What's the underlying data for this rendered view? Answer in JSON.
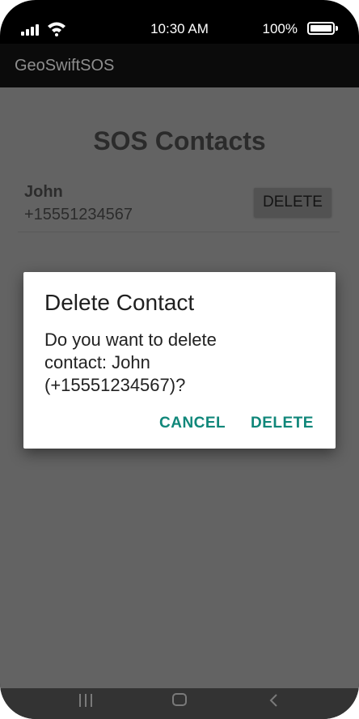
{
  "status_bar": {
    "time": "10:30 AM",
    "battery": "100%",
    "icons": [
      "signal-icon",
      "wifi-icon",
      "battery-icon"
    ]
  },
  "app_bar": {
    "title": "GeoSwiftSOS"
  },
  "screen": {
    "title": "SOS Contacts",
    "contacts": [
      {
        "name": "John",
        "phone": "+15551234567",
        "delete_label": "DELETE"
      }
    ]
  },
  "dialog": {
    "title": "Delete Contact",
    "message": "Do you want to delete contact: John (+15551234567)?",
    "cancel_label": "CANCEL",
    "confirm_label": "DELETE"
  },
  "nav_bar": {
    "icons": [
      "recent-apps-icon",
      "home-icon",
      "back-icon"
    ]
  },
  "colors": {
    "accent": "#10877a",
    "scrim": "#636363",
    "app_bar": "#0b0b0b"
  }
}
